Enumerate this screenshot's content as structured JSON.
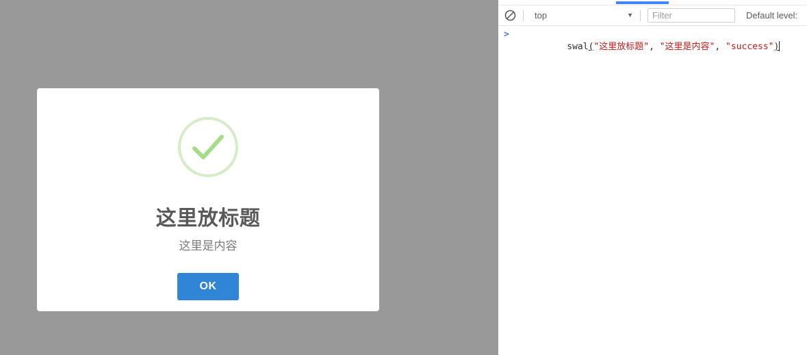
{
  "modal": {
    "icon": "success-check-icon",
    "icon_circle_color": "#d5ecc7",
    "icon_check_color": "#a5dc86",
    "title": "这里放标题",
    "text": "这里是内容",
    "confirm_label": "OK",
    "confirm_color": "#3085d6",
    "overlay_color": "#999999",
    "background": "#ffffff"
  },
  "devtools": {
    "active_tab_indicator_color": "#4285f4",
    "toolbar": {
      "clear_icon": "clear-console-icon",
      "context_selector_value": "top",
      "context_caret_icon": "chevron-down-icon",
      "filter_placeholder": "Filter",
      "filter_value": "",
      "level_label": "Default level:"
    },
    "console": {
      "prompt_symbol": ">",
      "input_tokens": [
        {
          "text": "swal",
          "type": "ident"
        },
        {
          "text": "(",
          "type": "paren"
        },
        {
          "text": "\"这里放标题\"",
          "type": "string"
        },
        {
          "text": ", ",
          "type": "punct"
        },
        {
          "text": "\"这里是内容\"",
          "type": "string"
        },
        {
          "text": ", ",
          "type": "punct"
        },
        {
          "text": "\"success\"",
          "type": "string"
        },
        {
          "text": ")",
          "type": "paren"
        }
      ],
      "input_raw": "swal(\"这里放标题\", \"这里是内容\", \"success\")",
      "string_color": "#c41a16",
      "prompt_color": "#4a7fd6"
    }
  }
}
